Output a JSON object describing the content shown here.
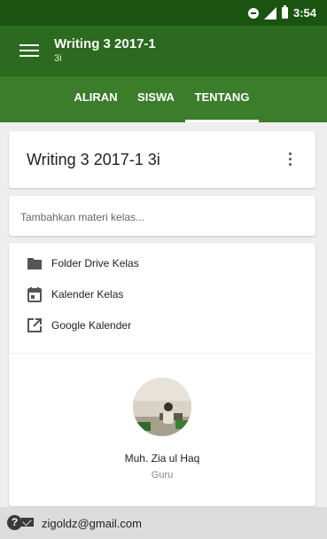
{
  "status_bar": {
    "time": "3:54",
    "icons": [
      "dnd-icon",
      "signal-icon",
      "battery-icon"
    ]
  },
  "app_bar": {
    "title": "Writing 3 2017-1",
    "subtitle": "3i",
    "menu_icon": "menu-icon"
  },
  "tabs": [
    {
      "label": "ALIRAN",
      "active": false
    },
    {
      "label": "SISWA",
      "active": false
    },
    {
      "label": "TENTANG",
      "active": true
    }
  ],
  "course": {
    "title": "Writing 3 2017-1 3i",
    "more_icon": "more-vert-icon"
  },
  "add_material": {
    "placeholder": "Tambahkan materi kelas..."
  },
  "links": [
    {
      "label": "Folder Drive Kelas",
      "icon": "folder-icon"
    },
    {
      "label": "Kalender Kelas",
      "icon": "calendar-icon"
    },
    {
      "label": "Google Kalender",
      "icon": "open-external-icon"
    }
  ],
  "teacher": {
    "name": "Muh. Zia ul Haq",
    "role": "Guru"
  },
  "footer": {
    "email": "zigoldz@gmail.com"
  },
  "colors": {
    "status_bar": "#1a5410",
    "app_bar": "#2b6a1f",
    "tab_bar": "#3b7d2a"
  }
}
